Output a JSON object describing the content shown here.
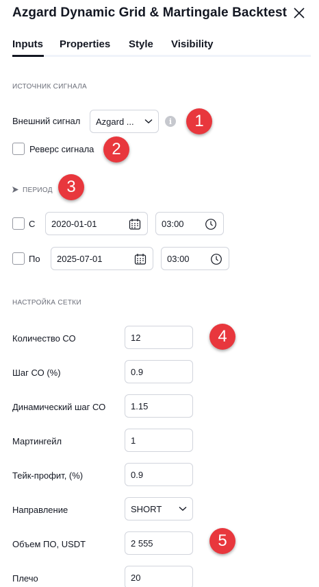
{
  "dialog": {
    "title": "Azgard Dynamic Grid & Martingale Backtest"
  },
  "tabs": [
    {
      "label": "Inputs",
      "active": true
    },
    {
      "label": "Properties"
    },
    {
      "label": "Style"
    },
    {
      "label": "Visibility"
    }
  ],
  "signal": {
    "section": "ИСТОЧНИК СИГНАЛА",
    "external_label": "Внешний сигнал",
    "external_value": "Azgard ...",
    "reverse_label": "Реверс сигнала",
    "reverse_checked": false
  },
  "period": {
    "label": "ПЕРИОД",
    "from_label": "С",
    "from_date": "2020-01-01",
    "from_time": "03:00",
    "to_label": "По",
    "to_date": "2025-07-01",
    "to_time": "03:00"
  },
  "grid": {
    "section": "НАСТРОЙКА СЕТКИ",
    "fields": [
      {
        "label": "Количество СО",
        "value": "12"
      },
      {
        "label": "Шаг СО (%)",
        "value": "0.9"
      },
      {
        "label": "Динамический шаг СО",
        "value": "1.15"
      },
      {
        "label": "Мартингейл",
        "value": "1"
      },
      {
        "label": "Тейк-профит, (%)",
        "value": "0.9"
      },
      {
        "label": "Направление",
        "value": "SHORT"
      },
      {
        "label": "Объем ПО, USDT",
        "value": "2 555"
      },
      {
        "label": "Плечо",
        "value": "20"
      }
    ]
  },
  "badges": [
    "1",
    "2",
    "3",
    "4",
    "5"
  ],
  "icons": {
    "close": "close-icon",
    "info": "info-icon",
    "calendar": "calendar-icon",
    "clock": "clock-icon",
    "chevron": "chevron-down-icon",
    "period_arrow": "arrow-right-icon"
  },
  "colors": {
    "badge": "#e8373d",
    "text": "#131722",
    "muted": "#6a6d78",
    "border": "#d1d4dc"
  }
}
